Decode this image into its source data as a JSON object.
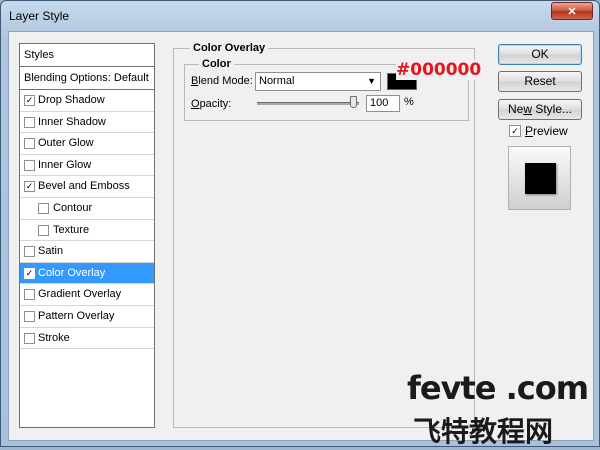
{
  "window": {
    "title": "Layer Style",
    "close_glyph": "✕"
  },
  "styles": {
    "header": "Styles",
    "blending_options": "Blending Options: Default",
    "items": [
      {
        "label": "Drop Shadow",
        "checked": true,
        "sub": false,
        "selected": false
      },
      {
        "label": "Inner Shadow",
        "checked": false,
        "sub": false,
        "selected": false
      },
      {
        "label": "Outer Glow",
        "checked": false,
        "sub": false,
        "selected": false
      },
      {
        "label": "Inner Glow",
        "checked": false,
        "sub": false,
        "selected": false
      },
      {
        "label": "Bevel and Emboss",
        "checked": true,
        "sub": false,
        "selected": false
      },
      {
        "label": "Contour",
        "checked": false,
        "sub": true,
        "selected": false
      },
      {
        "label": "Texture",
        "checked": false,
        "sub": true,
        "selected": false
      },
      {
        "label": "Satin",
        "checked": false,
        "sub": false,
        "selected": false
      },
      {
        "label": "Color Overlay",
        "checked": true,
        "sub": false,
        "selected": true
      },
      {
        "label": "Gradient Overlay",
        "checked": false,
        "sub": false,
        "selected": false
      },
      {
        "label": "Pattern Overlay",
        "checked": false,
        "sub": false,
        "selected": false
      },
      {
        "label": "Stroke",
        "checked": false,
        "sub": false,
        "selected": false
      }
    ]
  },
  "panel": {
    "title": "Color Overlay",
    "group_title": "Color",
    "blend_mode_label": "Blend Mode:",
    "blend_mode_label_key": "B",
    "blend_mode_label_rest": "lend Mode:",
    "blend_mode_value": "Normal",
    "color_hex": "#000000",
    "swatch_color": "#000000",
    "opacity_label_key": "O",
    "opacity_label_rest": "pacity:",
    "opacity_value": "100",
    "opacity_fraction": 1.0,
    "percent": "%"
  },
  "buttons": {
    "ok": "OK",
    "reset": "Reset",
    "new_style_key": "w",
    "new_style_pre": "Ne",
    "new_style_post": " Style..."
  },
  "preview": {
    "label_key": "P",
    "label_rest": "review",
    "checked": true
  },
  "watermark": {
    "en": "fevte .com",
    "cn": "飞特教程网"
  },
  "colors": {
    "selection": "#3399ff",
    "hex_label": "#e8141e"
  }
}
